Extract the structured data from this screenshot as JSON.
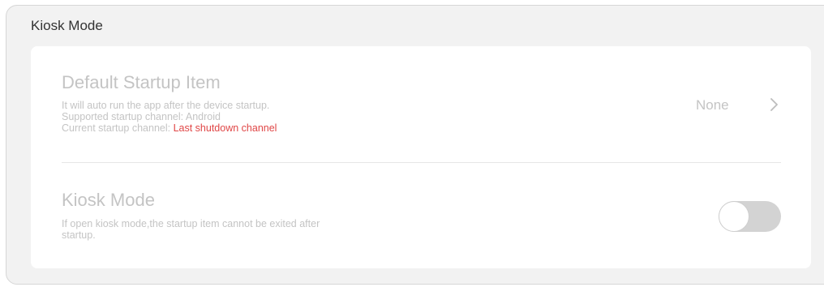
{
  "panel": {
    "title": "Kiosk Mode"
  },
  "startup_item": {
    "title": "Default Startup Item",
    "desc_line1": "It will auto run the app after the device startup.",
    "desc_line2": "Supported startup channel: Android",
    "desc_line3_prefix": "Current startup channel: ",
    "desc_line3_value": "Last shutdown channel",
    "value": "None",
    "chevron_icon": "chevron-right-icon"
  },
  "kiosk_mode": {
    "title": "Kiosk Mode",
    "desc_line1": "If open kiosk mode,the startup item cannot be exited after",
    "desc_line2": "startup.",
    "toggle_on": false
  },
  "colors": {
    "panel_bg": "#f2f2f2",
    "card_bg": "#ffffff",
    "muted_text": "#c4c4c4",
    "highlight": "#e04646",
    "toggle_track_off": "#d3d3d3"
  }
}
